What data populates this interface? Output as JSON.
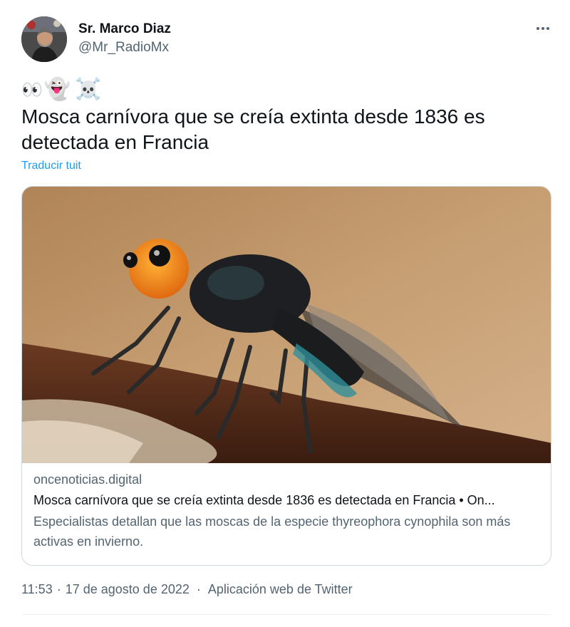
{
  "author": {
    "display_name": "Sr. Marco Diaz",
    "handle": "@Mr_RadioMx"
  },
  "more_icon": "more-horizontal-icon",
  "tweet": {
    "emojis": [
      "👀",
      "👻",
      "☠️"
    ],
    "text": "Mosca carnívora que se creía extinta desde 1836 es detectada en Francia",
    "translate_label": "Traducir tuit"
  },
  "card": {
    "image_subject": "fly",
    "domain": "oncenoticias.digital",
    "title": "Mosca carnívora que se creía extinta desde 1836 es detectada en Francia • On...",
    "description": "Especialistas detallan que las moscas de la especie thyreophora cynophila son más activas en invierno."
  },
  "meta": {
    "time": "11:53",
    "date": "17 de agosto de 2022",
    "separator": "·",
    "source": "Aplicación web de Twitter"
  },
  "colors": {
    "text_primary": "#0f1419",
    "text_secondary": "#536471",
    "link": "#1d9bf0",
    "border": "#cfd9de"
  }
}
